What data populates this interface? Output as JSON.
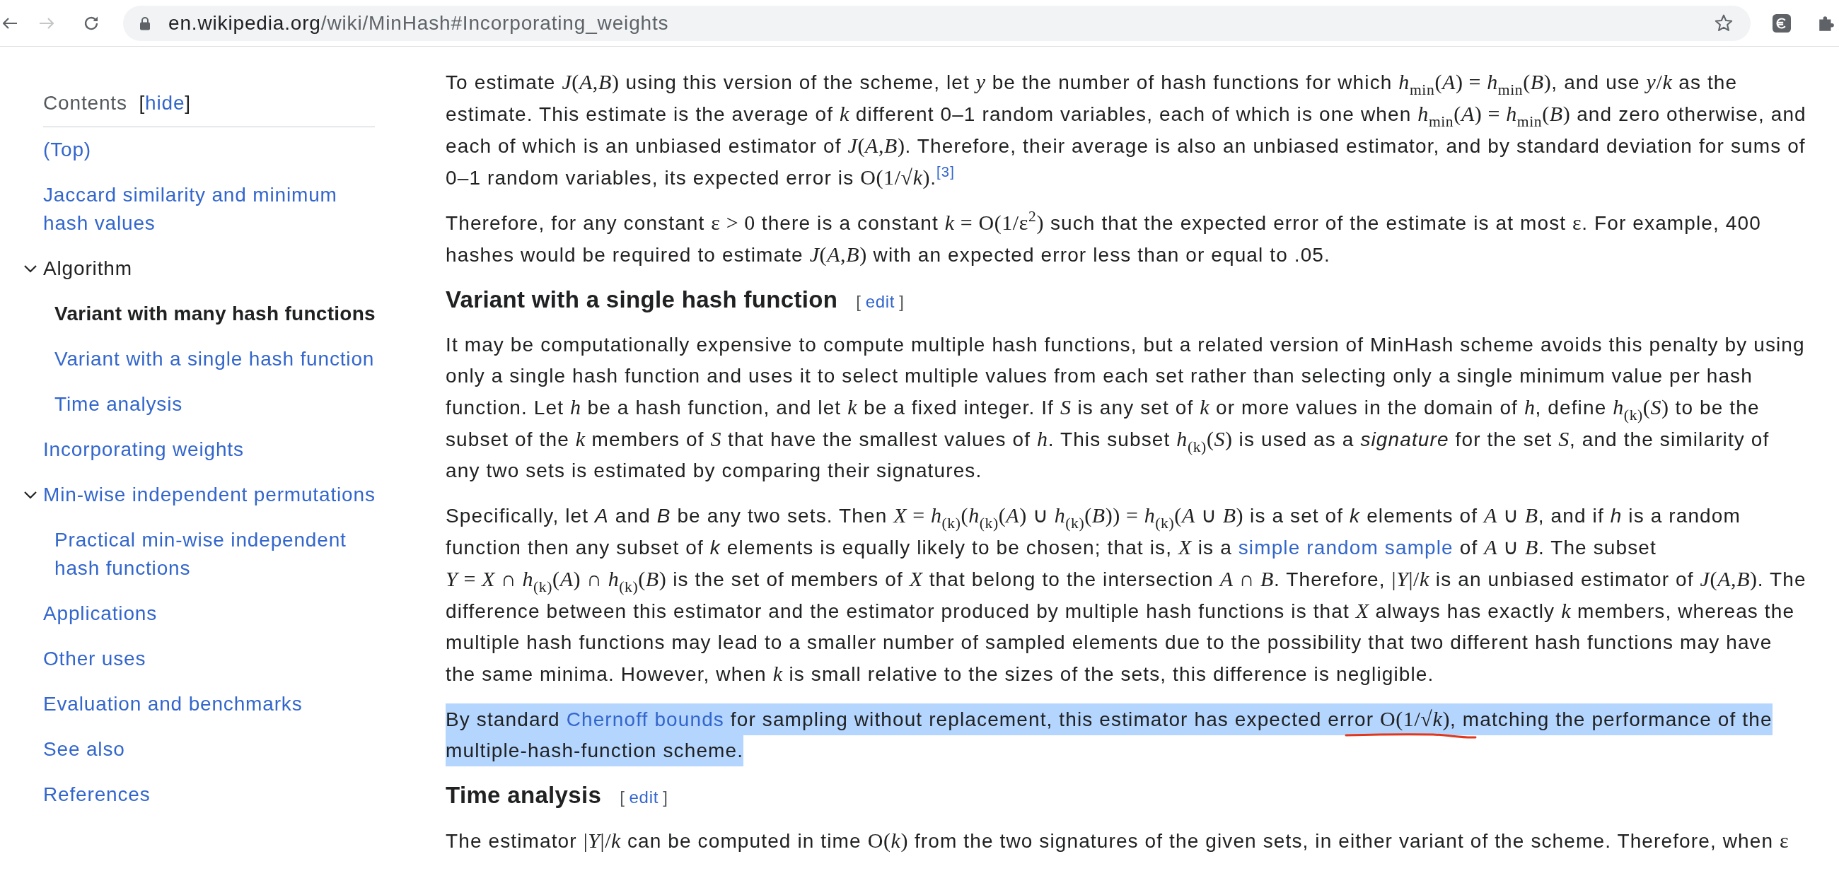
{
  "browser": {
    "url_host": "en.wikipedia.org",
    "url_path": "/wiki/MinHash#Incorporating_weights",
    "forward_disabled": true
  },
  "toc": {
    "title": "Contents",
    "hide": {
      "open": "[",
      "label": "hide",
      "close": "]"
    },
    "items": [
      {
        "label": "(Top)",
        "selected": false
      },
      {
        "label": "Jaccard similarity and minimum hash values",
        "selected": false
      },
      {
        "label": "Algorithm",
        "selected": false,
        "expanded": true,
        "children": [
          {
            "label": "Variant with many hash functions",
            "selected": true
          },
          {
            "label": "Variant with a single hash function",
            "selected": false
          },
          {
            "label": "Time analysis",
            "selected": false
          }
        ]
      },
      {
        "label": "Incorporating weights",
        "selected": false
      },
      {
        "label": "Min-wise independent permutations",
        "selected": false,
        "expanded": true,
        "children": [
          {
            "label": "Practical min-wise independent hash functions",
            "selected": false
          }
        ]
      },
      {
        "label": "Applications",
        "selected": false
      },
      {
        "label": "Other uses",
        "selected": false
      },
      {
        "label": "Evaluation and benchmarks",
        "selected": false
      },
      {
        "label": "See also",
        "selected": false
      },
      {
        "label": "References",
        "selected": false
      }
    ]
  },
  "article": {
    "blocks": [
      {
        "kind": "paragraph",
        "highlighted": false,
        "segments": [
          {
            "kind": "text",
            "text": "To estimate "
          },
          {
            "kind": "math",
            "text": "*J*(*A*,*B*)"
          },
          {
            "kind": "text",
            "text": " using this version of the scheme, let "
          },
          {
            "kind": "math",
            "text": "*y*"
          },
          {
            "kind": "text",
            "text": " be the number of hash functions for which "
          },
          {
            "kind": "math",
            "text": "*h*$_{min}$(*A*) = *h*$_{min}$(*B*)"
          },
          {
            "kind": "text",
            "text": ", and use "
          },
          {
            "kind": "math",
            "text": "*y*/*k*"
          },
          {
            "kind": "text",
            "text": " as the estimate. This estimate is the average of "
          },
          {
            "kind": "math",
            "text": "*k*"
          },
          {
            "kind": "text",
            "text": " different 0–1 random variables, each of which is one when "
          },
          {
            "kind": "math",
            "text": "*h*$_{min}$(*A*) = *h*$_{min}$(*B*)"
          },
          {
            "kind": "text",
            "text": " and zero otherwise, and each of which is an unbiased estimator of "
          },
          {
            "kind": "math",
            "text": "*J*(*A*,*B*)"
          },
          {
            "kind": "text",
            "text": ". Therefore, their average is also an unbiased estimator, and by standard deviation for sums of 0–1 random variables, its expected error is "
          },
          {
            "kind": "math",
            "text": "O(1/√*k*)"
          },
          {
            "kind": "text",
            "text": "."
          },
          {
            "kind": "ref",
            "text": "[3]"
          }
        ]
      },
      {
        "kind": "paragraph",
        "highlighted": false,
        "segments": [
          {
            "kind": "text",
            "text": "Therefore, for any constant "
          },
          {
            "kind": "math",
            "text": "ε > 0"
          },
          {
            "kind": "text",
            "text": " there is a constant "
          },
          {
            "kind": "math",
            "text": "*k* = O(1/ε$^{2}$)"
          },
          {
            "kind": "text",
            "text": " such that the expected error of the estimate is at most "
          },
          {
            "kind": "math",
            "text": "ε"
          },
          {
            "kind": "text",
            "text": ". For example, 400 hashes would be required to estimate "
          },
          {
            "kind": "math",
            "text": "*J*(*A*,*B*)"
          },
          {
            "kind": "text",
            "text": " with an expected error less than or equal to .05."
          }
        ]
      },
      {
        "kind": "heading",
        "text": "Variant with a single hash function",
        "edit": {
          "open": "[",
          "label": "edit",
          "close": "]"
        }
      },
      {
        "kind": "paragraph",
        "highlighted": false,
        "segments": [
          {
            "kind": "text",
            "text": "It may be computationally expensive to compute multiple hash functions, but a related version of MinHash scheme avoids this penalty by using only a single hash function and uses it to select multiple values from each set rather than selecting only a single minimum value per hash function. Let "
          },
          {
            "kind": "math",
            "text": "*h*"
          },
          {
            "kind": "text",
            "text": " be a hash function, and let "
          },
          {
            "kind": "math",
            "text": "*k*"
          },
          {
            "kind": "text",
            "text": " be a fixed integer. If "
          },
          {
            "kind": "math",
            "text": "*S*"
          },
          {
            "kind": "text",
            "text": " is any set of "
          },
          {
            "kind": "math",
            "text": "*k*"
          },
          {
            "kind": "text",
            "text": " or more values in the domain of "
          },
          {
            "kind": "math",
            "text": "*h*"
          },
          {
            "kind": "text",
            "text": ", define "
          },
          {
            "kind": "math",
            "text": "*h*$_{(k)}$(*S*)"
          },
          {
            "kind": "text",
            "text": " to be the subset of the "
          },
          {
            "kind": "math",
            "text": "*k*"
          },
          {
            "kind": "text",
            "text": " members of "
          },
          {
            "kind": "math",
            "text": "*S*"
          },
          {
            "kind": "text",
            "text": " that have the smallest values of "
          },
          {
            "kind": "math",
            "text": "*h*"
          },
          {
            "kind": "text",
            "text": ". This subset "
          },
          {
            "kind": "math",
            "text": "*h*$_{(k)}$(*S*)"
          },
          {
            "kind": "text",
            "text": " is used as a *signature* for the set "
          },
          {
            "kind": "math",
            "text": "*S*"
          },
          {
            "kind": "text",
            "text": ", and the similarity of any two sets is estimated by comparing their signatures."
          }
        ]
      },
      {
        "kind": "paragraph",
        "highlighted": false,
        "segments": [
          {
            "kind": "text",
            "text": "Specifically, let *A* and *B* be any two sets. Then "
          },
          {
            "kind": "math",
            "text": "*X* = *h*$_{(k)}$(*h*$_{(k)}$(*A*) ∪ *h*$_{(k)}$(*B*)) = *h*$_{(k)}$(*A* ∪ *B*)"
          },
          {
            "kind": "text",
            "text": " is a set of *k* elements of "
          },
          {
            "kind": "math",
            "text": "*A* ∪ *B*"
          },
          {
            "kind": "text",
            "text": ", and if *h* is a random function then any subset of *k* elements is equally likely to be chosen; that is, "
          },
          {
            "kind": "math",
            "text": "*X*"
          },
          {
            "kind": "text",
            "text": " is a "
          },
          {
            "kind": "link",
            "text": "simple random sample"
          },
          {
            "kind": "text",
            "text": " of "
          },
          {
            "kind": "math",
            "text": "*A* ∪ *B*"
          },
          {
            "kind": "text",
            "text": ". The subset "
          },
          {
            "kind": "math",
            "text": "*Y* = *X* ∩ *h*$_{(k)}$(*A*) ∩ *h*$_{(k)}$(*B*)"
          },
          {
            "kind": "text",
            "text": " is the set of members of "
          },
          {
            "kind": "math",
            "text": "*X*"
          },
          {
            "kind": "text",
            "text": " that belong to the intersection "
          },
          {
            "kind": "math",
            "text": "*A* ∩ *B*"
          },
          {
            "kind": "text",
            "text": ". Therefore, "
          },
          {
            "kind": "math",
            "text": "|*Y*|/*k*"
          },
          {
            "kind": "text",
            "text": " is an unbiased estimator of "
          },
          {
            "kind": "math",
            "text": "*J*(*A*,*B*)"
          },
          {
            "kind": "text",
            "text": ". The difference between this estimator and the estimator produced by multiple hash functions is that "
          },
          {
            "kind": "math",
            "text": "*X*"
          },
          {
            "kind": "text",
            "text": " always has exactly "
          },
          {
            "kind": "math",
            "text": "*k*"
          },
          {
            "kind": "text",
            "text": " members, whereas the multiple hash functions may lead to a smaller number of sampled elements due to the possibility that two different hash functions may have the same minima. However, when "
          },
          {
            "kind": "math",
            "text": "*k*"
          },
          {
            "kind": "text",
            "text": " is small relative to the sizes of the sets, this difference is negligible."
          }
        ]
      },
      {
        "kind": "paragraph",
        "highlighted": true,
        "segments": [
          {
            "kind": "text",
            "text": "By standard "
          },
          {
            "kind": "link",
            "text": "Chernoff bounds"
          },
          {
            "kind": "text",
            "text": " for sampling without replacement, this estimator has expected error "
          },
          {
            "kind": "math",
            "text": "O(1/√*k*)",
            "annotated": true
          },
          {
            "kind": "text",
            "text": ", matching the performance of the multiple-hash-function scheme."
          }
        ]
      },
      {
        "kind": "heading",
        "text": "Time analysis",
        "edit": {
          "open": "[",
          "label": "edit",
          "close": "]"
        }
      },
      {
        "kind": "paragraph",
        "highlighted": false,
        "segments": [
          {
            "kind": "text",
            "text": "The estimator "
          },
          {
            "kind": "math",
            "text": "|*Y*|/*k*"
          },
          {
            "kind": "text",
            "text": " can be computed in time "
          },
          {
            "kind": "math",
            "text": "O(*k*)"
          },
          {
            "kind": "text",
            "text": " from the two signatures of the given sets, in either variant of the scheme. Therefore, when "
          },
          {
            "kind": "math",
            "text": "ε"
          }
        ]
      }
    ]
  }
}
